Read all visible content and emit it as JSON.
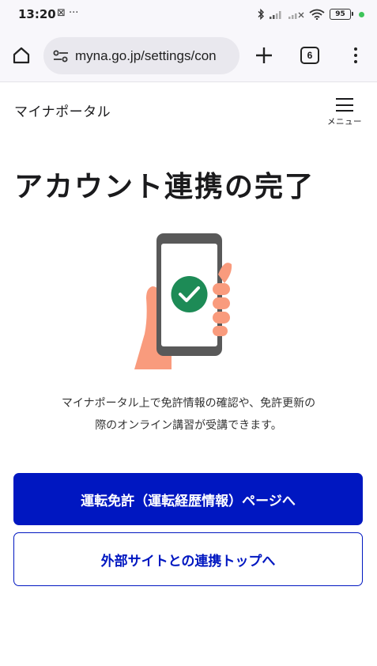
{
  "status_bar": {
    "time": "13:20",
    "left_icons": "⊠ ···",
    "battery": "95"
  },
  "browser": {
    "url": "myna.go.jp/settings/con",
    "tab_count": "6"
  },
  "header": {
    "logo": "マイナポータル",
    "menu_label": "メニュー"
  },
  "main": {
    "title": "アカウント連携の完了",
    "description_line1": "マイナポータル上で免許情報の確認や、免許更新の",
    "description_line2": "際のオンライン講習が受講できます。",
    "primary_button": "運転免許（運転経歴情報）ページへ",
    "secondary_button": "外部サイトとの連携トップへ"
  },
  "colors": {
    "accent": "#0017c1",
    "check": "#1d8b56",
    "skin": "#f99b7d"
  },
  "icons": {
    "home": "home-icon",
    "site_settings": "tune-icon",
    "new_tab": "plus-icon",
    "tabs": "tab-switcher-icon",
    "more": "more-vert-icon",
    "menu": "hamburger-icon"
  }
}
